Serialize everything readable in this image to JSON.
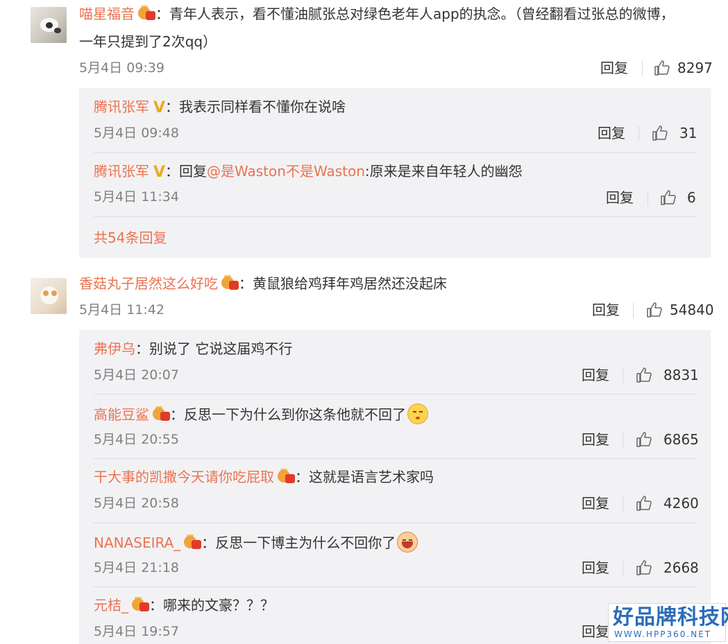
{
  "comments": [
    {
      "username": "喵星福音",
      "separator": "：",
      "text_line1": "青年人表示，看不懂油腻张总对绿色老年人app的执念。（曾经翻看过张总的微博，",
      "text_line2": "一年只提到了2次qq）",
      "time": "5月4日 09:39",
      "reply_label": "回复",
      "likes": "8297",
      "replies": [
        {
          "username": "腾讯张军",
          "verified": "V",
          "separator": "：",
          "text": "我表示同样看不懂你在说啥",
          "time": "5月4日 09:48",
          "reply_label": "回复",
          "likes": "31"
        },
        {
          "username": "腾讯张军",
          "verified": "V",
          "separator": "：",
          "reply_prefix": "回复",
          "mention": "@是Waston不是Waston",
          "text": ":原来是来自年轻人的幽怨",
          "time": "5月4日 11:34",
          "reply_label": "回复",
          "likes": "6"
        }
      ],
      "more_replies": "共54条回复"
    },
    {
      "username": "香菇丸子居然这么好吃",
      "separator": "：",
      "text": "黄鼠狼给鸡拜年鸡居然还没起床",
      "time": "5月4日 11:42",
      "reply_label": "回复",
      "likes": "54840",
      "replies": [
        {
          "username": "弗伊乌",
          "separator": "：",
          "text": "别说了 它说这届鸡不行",
          "time": "5月4日 20:07",
          "reply_label": "回复",
          "likes": "8831"
        },
        {
          "username": "高能豆鲨",
          "separator": "：",
          "text": "反思一下为什么到你这条他就不回了",
          "time": "5月4日 20:55",
          "reply_label": "回复",
          "likes": "6865"
        },
        {
          "username": "干大事的凯撒今天请你吃屁取",
          "separator": "：",
          "text": "这就是语言艺术家吗",
          "time": "5月4日 20:58",
          "reply_label": "回复",
          "likes": "4260"
        },
        {
          "username": "NANASEIRA_",
          "separator": "：",
          "text": "反思一下博主为什么不回你了",
          "time": "5月4日 21:18",
          "reply_label": "回复",
          "likes": "2668"
        },
        {
          "username": "元桔_",
          "separator": "：",
          "text": "哪来的文豪？？？",
          "time": "5月4日 19:57",
          "reply_label": "回复",
          "likes": ""
        }
      ]
    }
  ],
  "watermark": {
    "title": "好品牌科技网",
    "url": "WWW.HPP360.NET"
  },
  "colors": {
    "username": "#eb7350",
    "meta": "#808080",
    "sub_box": "#f2f2f5",
    "vip_badge": "#f0a818"
  }
}
